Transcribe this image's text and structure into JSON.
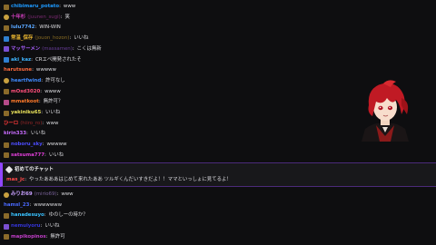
{
  "chat": {
    "messages": [
      {
        "user": "chibimaru_potato",
        "alias": "",
        "sep": ":",
        "text": "www",
        "color": "#1e9aff",
        "badge": "sub"
      },
      {
        "user": "十年杉",
        "alias": "(juunen_sugi)",
        "sep": ":",
        "text": "笑",
        "color": "#d13fbf",
        "badge": "star"
      },
      {
        "user": "lulu7742",
        "alias": "",
        "sep": ":",
        "text": "WIN-WIN",
        "color": "#5aa7ff",
        "badge": "sub"
      },
      {
        "user": "常温_保存",
        "alias": "(jouon_hozon)",
        "sep": ":",
        "text": "いいね",
        "color": "#e9b530",
        "badge": "prime"
      },
      {
        "user": "マッサーメン",
        "alias": "(massamen)",
        "sep": ":",
        "text": "こくは無新",
        "color": "#a95fff",
        "badge": "hype"
      },
      {
        "user": "aki_kaz",
        "alias": "",
        "sep": ":",
        "text": "CRエペ開発されたそ",
        "color": "#3fb6ff",
        "badge": "prime"
      },
      {
        "user": "harutsune",
        "alias": "",
        "sep": ":",
        "text": "wwwww",
        "color": "#ff6a3d",
        "badge": ""
      },
      {
        "user": "heartfwind",
        "alias": "",
        "sep": ":",
        "text": "許可なし",
        "color": "#3f8bff",
        "badge": "star"
      },
      {
        "user": "mOsd3020",
        "alias": "",
        "sep": ":",
        "text": "wwww",
        "color": "#ff4f7b",
        "badge": "sub"
      },
      {
        "user": "mmatkoot",
        "alias": "",
        "sep": ":",
        "text": "無許可？",
        "color": "#ff7a2a",
        "badge": "gift"
      },
      {
        "user": "yakiniku65",
        "alias": "",
        "sep": ":",
        "text": "いいね",
        "color": "#e8e15a",
        "badge": "sub"
      },
      {
        "user": "ひーロ",
        "alias": "(hiiro_ro)",
        "sep": ":",
        "text": "www",
        "color": "#ff3a3a",
        "badge": ""
      },
      {
        "user": "kirin333",
        "alias": "",
        "sep": ":",
        "text": "いいね",
        "color": "#c96cff",
        "badge": ""
      },
      {
        "user": "noboru_sky",
        "alias": "",
        "sep": ":",
        "text": "wwwww",
        "color": "#4d4dff",
        "badge": "sub"
      },
      {
        "user": "satsuma777",
        "alias": "",
        "sep": ":",
        "text": "いいね",
        "color": "#e03fd8",
        "badge": "sub"
      }
    ],
    "first_chat": {
      "title": "初めてのチャット",
      "user": "mas_jc",
      "sep": ":",
      "text": "やったあああはじめて来れたああ ツルギくんだいすきだよ！！ママといっしょに見てるよ！",
      "color": "#ff4a4a"
    },
    "after": [
      {
        "user": "みりお69",
        "alias": "(mirio69)",
        "sep": ":",
        "text": "www",
        "color": "#c8a0ff",
        "badge": "star"
      },
      {
        "user": "hamsl_23",
        "alias": "",
        "sep": ":",
        "text": "wwwwwww",
        "color": "#4a6aff",
        "badge": ""
      },
      {
        "user": "hanadesuyo",
        "alias": "",
        "sep": ":",
        "text": "ゆのしーの時か？",
        "color": "#39c2ff",
        "badge": "sub"
      },
      {
        "user": "nemuiyoru",
        "alias": "",
        "sep": ":",
        "text": "いいね",
        "color": "#3535d8",
        "badge": "hype"
      },
      {
        "user": "mapikopinos",
        "alias": "",
        "sep": ":",
        "text": "無許可",
        "color": "#c23ec9",
        "badge": "sub"
      }
    ]
  },
  "colors": {
    "background": "#0e0e10",
    "highlight": "#9147ff",
    "text": "#dcdce0"
  },
  "icons": [
    "badge-icon",
    "first-chat-icon"
  ]
}
